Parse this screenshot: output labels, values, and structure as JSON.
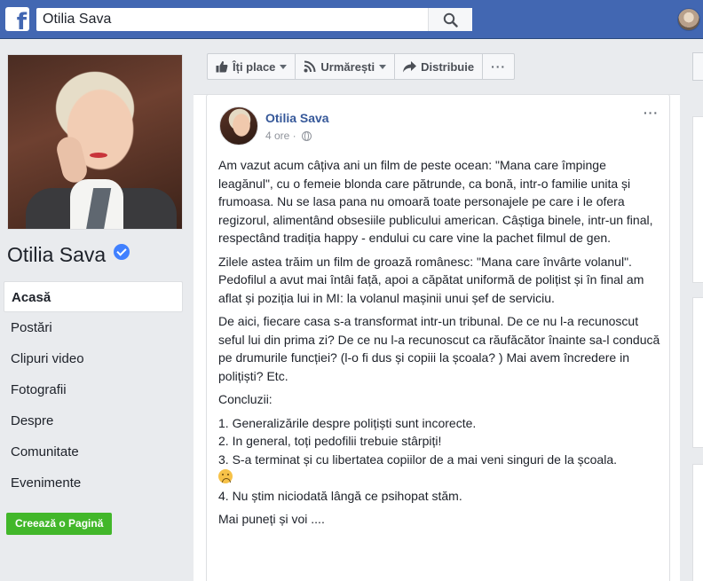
{
  "header": {
    "logo_icon": "facebook-f-icon",
    "search": {
      "value": "Otilia Sava",
      "icon": "search-icon"
    },
    "avatar_icon": "user-avatar"
  },
  "profile": {
    "name": "Otilia Sava",
    "verified_icon": "verified-badge-icon"
  },
  "sidebar": {
    "items": [
      {
        "label": "Acasă",
        "active": true
      },
      {
        "label": "Postări"
      },
      {
        "label": "Clipuri video"
      },
      {
        "label": "Fotografii"
      },
      {
        "label": "Despre"
      },
      {
        "label": "Comunitate"
      },
      {
        "label": "Evenimente"
      }
    ],
    "create_page_label": "Creează o Pagină"
  },
  "actions": {
    "like": "Îți place",
    "follow": "Urmărești",
    "share": "Distribuie",
    "more": "···"
  },
  "post": {
    "author": "Otilia Sava",
    "time": "4 ore ·",
    "options": "···",
    "paragraphs": [
      "Am vazut acum câțiva ani un film de peste ocean: \"Mana care împinge leagănul\", cu o femeie blonda care pătrunde, ca bonă, intr-o familie unita și frumoasa. Nu se lasa pana nu omoară toate personajele pe care i le ofera regizorul, alimentând obsesiile publicului american. Câștiga binele, intr-un final, respectând tradiția happy - endului cu care vine la pachet filmul de gen.",
      "Zilele astea trăim un film de groază românesc: \"Mana care învârte volanul\". Pedofilul a avut mai întâi față, apoi a căpătat uniformă de polițist și în final am aflat și poziția lui in MI: la volanul mașinii unui șef de serviciu.",
      "De aici, fiecare casa s-a transformat intr-un tribunal. De ce nu l-a recunoscut seful lui din prima zi? De ce nu l-a recunoscut ca răufăcător înainte sa-l conducă pe drumurile funcției? (l-o fi dus și copiii la școala? ) Mai avem încredere in polițiști? Etc.",
      "Concluzii:"
    ],
    "list": [
      "1. Generalizările despre polițiști sunt incorecte.",
      "2. In general, toți pedofilii trebuie stârpiți!",
      "3. S-a terminat și cu libertatea copiilor de a mai veni singuri de la școala.",
      "4. Nu știm niciodată lângă ce psihopat stăm."
    ],
    "closing": "Mai puneți și voi ....",
    "sad_emoji": "sad-face-emoji"
  },
  "colors": {
    "topbar": "#4267b2",
    "link": "#365899",
    "create_button": "#42b72a",
    "verified": "#4080ff",
    "background": "#e9ebee"
  }
}
